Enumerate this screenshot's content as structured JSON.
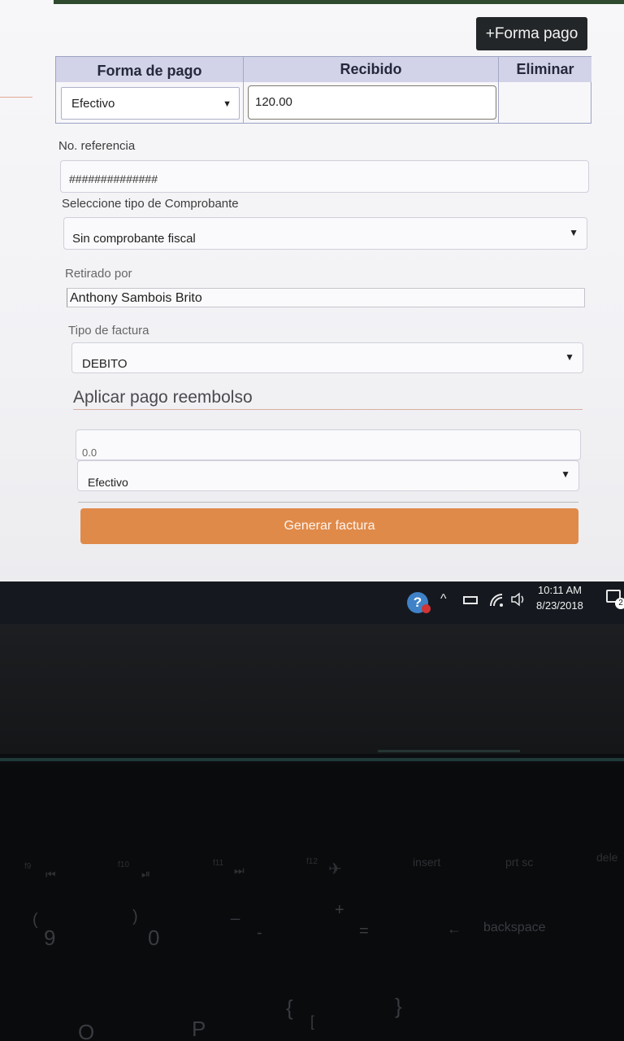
{
  "toolbar": {
    "add_payment_label": "+Forma pago"
  },
  "payment_table": {
    "headers": [
      "Forma de pago",
      "Recibido",
      "Eliminar"
    ],
    "row": {
      "method": "Efectivo",
      "received": "120.00"
    }
  },
  "reference": {
    "label": "No. referencia",
    "value": "##############"
  },
  "voucher": {
    "label": "Seleccione tipo de Comprobante",
    "value": "Sin comprobante fiscal"
  },
  "picked_up_by": {
    "label": "Retirado por",
    "value": "Anthony Sambois Brito"
  },
  "invoice_type": {
    "label": "Tipo de factura",
    "value": "DEBITO"
  },
  "refund": {
    "title": "Aplicar pago reembolso",
    "amount": "0.0",
    "method": "Efectivo"
  },
  "generate_button": "Generar factura",
  "taskbar": {
    "time": "10:11 AM",
    "date": "8/23/2018",
    "notification_count": "2"
  },
  "keyboard": {
    "fn_keys": [
      "f9",
      "f10",
      "f11",
      "f12",
      "insert",
      "prt sc",
      "dele"
    ],
    "keys": [
      "(",
      "9",
      ")",
      "0",
      "_",
      "-",
      "+",
      "=",
      "backspace",
      "{",
      "[",
      "}",
      "P",
      "O"
    ]
  },
  "icons": {
    "dropdown": "caret-down-icon",
    "help": "help-icon",
    "tray": [
      "chevron-up-icon",
      "battery-icon",
      "wifi-icon",
      "volume-icon",
      "notification-icon"
    ]
  }
}
